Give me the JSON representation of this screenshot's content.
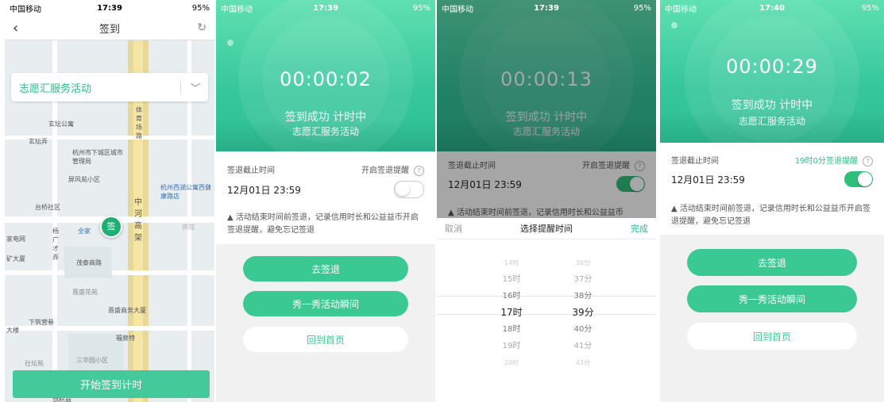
{
  "status": {
    "carrier": "中国移动",
    "times": [
      "17:39",
      "17:39",
      "17:39",
      "17:40"
    ],
    "battery": "95%"
  },
  "screen1": {
    "nav_title": "签到",
    "activity": "志愿汇服务活动",
    "start_button": "开始签到计时",
    "pin_label": "签",
    "map_labels": [
      "玄坛公寓",
      "玄坛弄",
      "杭州市下城区城市管理局",
      "体育场路",
      "屏风苑小区",
      "杭州西湖公寓西健康路店",
      "台桥社区",
      "中河高架",
      "资院",
      "家电网",
      "杨广才弄",
      "全家",
      "矿大厦",
      "茂泰商路",
      "熹盛花苑",
      "熹盛商务大厦",
      "下筑营巷",
      "福泉特",
      "大楼",
      "三华园小区",
      "社坛苑",
      "荫杭商"
    ]
  },
  "screen2": {
    "timer": "00:00:02",
    "status": "签到成功 计时中",
    "activity": "志愿汇服务活动",
    "deadline_label": "签退截止时间",
    "reminder_label": "开启签退提醒",
    "deadline_value": "12月01日 23:59",
    "note": "活动结束时间前签退，记录信用时长和公益益币开启签退提醒，避免忘记签退",
    "btn_checkout": "去签退",
    "btn_show": "秀一秀活动瞬间",
    "btn_home": "回到首页"
  },
  "screen3": {
    "timer": "00:00:13",
    "status": "签到成功 计时中",
    "activity": "志愿汇服务活动",
    "deadline_label": "签退截止时间",
    "reminder_label": "开启签退提醒",
    "deadline_value": "12月01日 23:59",
    "note": "活动结束时间前签退，记录信用时长和公益益币",
    "picker": {
      "cancel": "取消",
      "title": "选择提醒时间",
      "done": "完成",
      "hours": [
        "14时",
        "15时",
        "16时",
        "17时",
        "18时",
        "19时",
        "20时"
      ],
      "minutes": [
        "36分",
        "37分",
        "38分",
        "39分",
        "40分",
        "41分",
        "42分"
      ],
      "selected_hour": "17时",
      "selected_minute": "39分"
    }
  },
  "screen4": {
    "timer": "00:00:29",
    "status": "签到成功 计时中",
    "activity": "志愿汇服务活动",
    "deadline_label": "签退截止时间",
    "reminder_label": "19时0分签退提醒",
    "deadline_value": "12月01日 23:59",
    "note": "活动结束时间前签退，记录信用时长和公益益币开启签退提醒，避免忘记签退",
    "btn_checkout": "去签退",
    "btn_show": "秀一秀活动瞬间",
    "btn_home": "回到首页"
  }
}
